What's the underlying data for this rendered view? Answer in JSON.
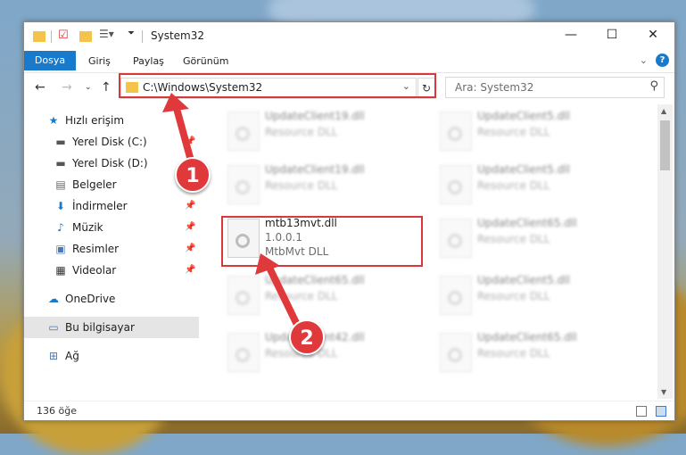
{
  "window": {
    "title": "System32"
  },
  "ribbon": {
    "tabs": [
      "Dosya",
      "Giriş",
      "Paylaş",
      "Görünüm"
    ]
  },
  "address": {
    "path": "C:\\Windows\\System32"
  },
  "search": {
    "placeholder": "Ara: System32"
  },
  "sidebar": {
    "items": [
      {
        "label": "Hızlı erişim"
      },
      {
        "label": "Yerel Disk (C:)"
      },
      {
        "label": "Yerel Disk (D:)"
      },
      {
        "label": "Belgeler"
      },
      {
        "label": "İndirmeler"
      },
      {
        "label": "Müzik"
      },
      {
        "label": "Resimler"
      },
      {
        "label": "Videolar"
      },
      {
        "label": "OneDrive"
      },
      {
        "label": "Bu bilgisayar"
      },
      {
        "label": "Ağ"
      }
    ]
  },
  "files": [
    {
      "name": "UpdateClient19.dll",
      "desc": "Resource DLL"
    },
    {
      "name": "UpdateClient5.dll",
      "desc": "Resource DLL"
    },
    {
      "name": "UpdateClient19.dll",
      "desc": "Resource DLL"
    },
    {
      "name": "UpdateClient5.dll",
      "desc": "Resource DLL"
    },
    {
      "name": "mtb13mvt.dll",
      "version": "1.0.0.1",
      "desc": "MtbMvt DLL"
    },
    {
      "name": "UpdateClient65.dll",
      "desc": "Resource DLL"
    },
    {
      "name": "UpdateClient65.dll",
      "desc": "Resource DLL"
    },
    {
      "name": "UpdateClient5.dll",
      "desc": "Resource DLL"
    },
    {
      "name": "UpdateClient42.dll",
      "desc": "Resource DLL"
    },
    {
      "name": "UpdateClient65.dll",
      "desc": "Resource DLL"
    }
  ],
  "status": {
    "count": "136 öğe"
  },
  "annotations": {
    "step1": "1",
    "step2": "2"
  },
  "colors": {
    "accent": "#1979ca",
    "highlight": "#d9383a"
  }
}
